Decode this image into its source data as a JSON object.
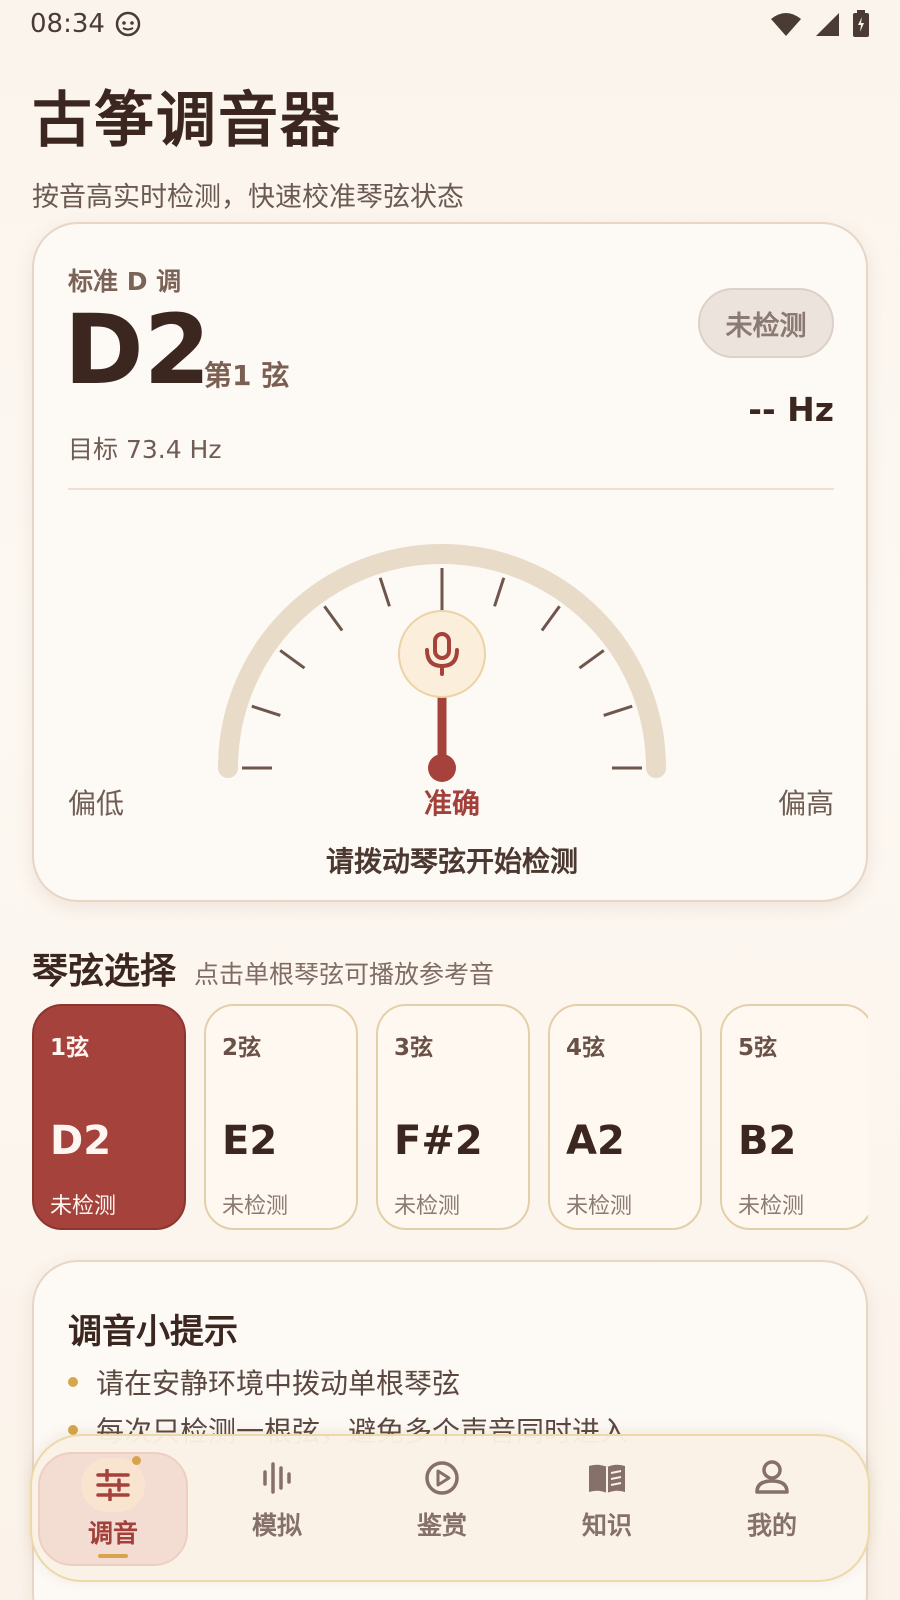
{
  "status_bar": {
    "time": "08:34"
  },
  "header": {
    "title": "古筝调音器",
    "subtitle": "按音高实时检测，快速校准琴弦状态"
  },
  "tuner": {
    "mode": "标准 D 调",
    "note": "D2",
    "string": "第1 弦",
    "target": "目标 73.4 Hz",
    "status": "未检测",
    "hz": "-- Hz",
    "label_low": "偏低",
    "label_center": "准确",
    "label_high": "偏高",
    "prompt": "请拨动琴弦开始检测",
    "needle_cents": 0
  },
  "strings_section": {
    "title": "琴弦选择",
    "hint": "点击单根琴弦可播放参考音",
    "items": [
      {
        "num": "1弦",
        "note": "D2",
        "state": "未检测",
        "active": true
      },
      {
        "num": "2弦",
        "note": "E2",
        "state": "未检测",
        "active": false
      },
      {
        "num": "3弦",
        "note": "F#2",
        "state": "未检测",
        "active": false
      },
      {
        "num": "4弦",
        "note": "A2",
        "state": "未检测",
        "active": false
      },
      {
        "num": "5弦",
        "note": "B2",
        "state": "未检测",
        "active": false
      }
    ]
  },
  "tips": {
    "title": "调音小提示",
    "items": [
      "请在安静环境中拨动单根琴弦",
      "每次只检测一根弦，避免多个声音同时进入"
    ]
  },
  "bottom_nav": {
    "items": [
      {
        "label": "调音",
        "icon": "sliders-icon",
        "active": true
      },
      {
        "label": "模拟",
        "icon": "waveform-icon",
        "active": false
      },
      {
        "label": "鉴赏",
        "icon": "play-circle-icon",
        "active": false
      },
      {
        "label": "知识",
        "icon": "book-icon",
        "active": false
      },
      {
        "label": "我的",
        "icon": "user-icon",
        "active": false
      }
    ]
  },
  "colors": {
    "accent": "#a5423c",
    "gold": "#d9a44b",
    "background": "#fbf4ec",
    "gauge_track": "#e8dcc9"
  }
}
